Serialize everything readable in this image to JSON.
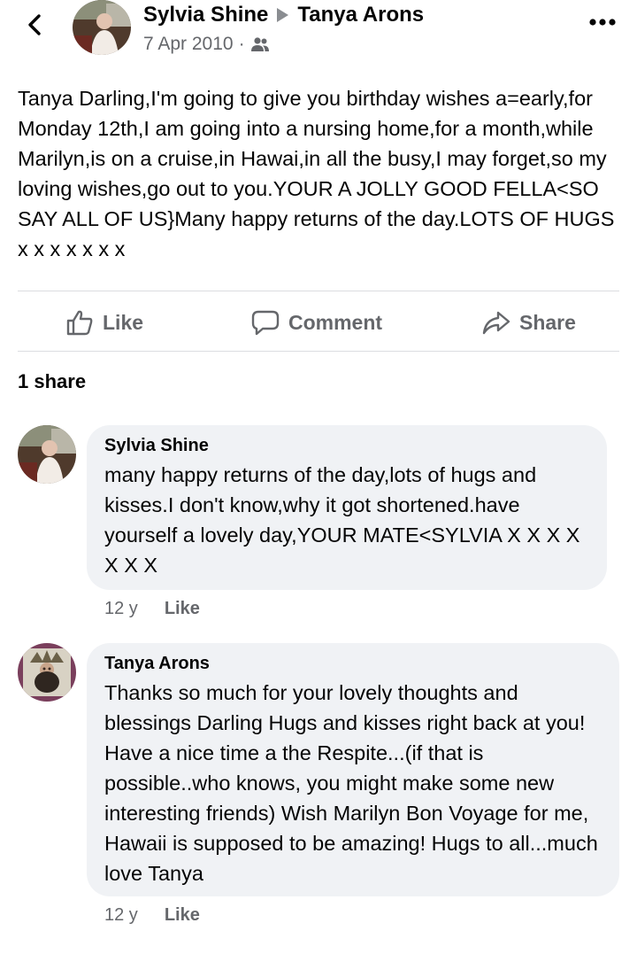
{
  "post": {
    "author": "Sylvia Shine",
    "recipient": "Tanya Arons",
    "date": "7 Apr 2010",
    "separator": "·",
    "audience_icon": "friends-icon",
    "text": "Tanya Darling,I'm going to give you birthday wishes a=early,for Monday 12th,I am going into a nursing home,for a month,while Marilyn,is on a cruise,in Hawai,in all the busy,I may forget,so my loving wishes,go out to you.YOUR A JOLLY GOOD FELLA<SO SAY ALL OF US}Many happy returns of the day.LOTS OF HUGS  x x x x x x x"
  },
  "actions": {
    "like": "Like",
    "comment": "Comment",
    "share": "Share"
  },
  "shares": "1 share",
  "comments": [
    {
      "author": "Sylvia Shine",
      "text": "many happy returns of the day,lots of hugs and kisses.I don't know,why it got shortened.have yourself a lovely day,YOUR MATE<SYLVIA X X X X X X X",
      "age": "12 y",
      "like": "Like"
    },
    {
      "author": "Tanya Arons",
      "text": "Thanks so much for your lovely thoughts and blessings Darling  Hugs and kisses right back at you!  Have a nice time a the Respite...(if that is possible..who knows, you might make some new interesting friends)  Wish Marilyn Bon Voyage for me, Hawaii is supposed to be amazing!  Hugs to all...much love  Tanya",
      "age": "12 y",
      "like": "Like"
    }
  ],
  "colors": {
    "secondary_text": "#65676b",
    "bubble": "#f0f2f5",
    "divider": "#dcdde1"
  }
}
